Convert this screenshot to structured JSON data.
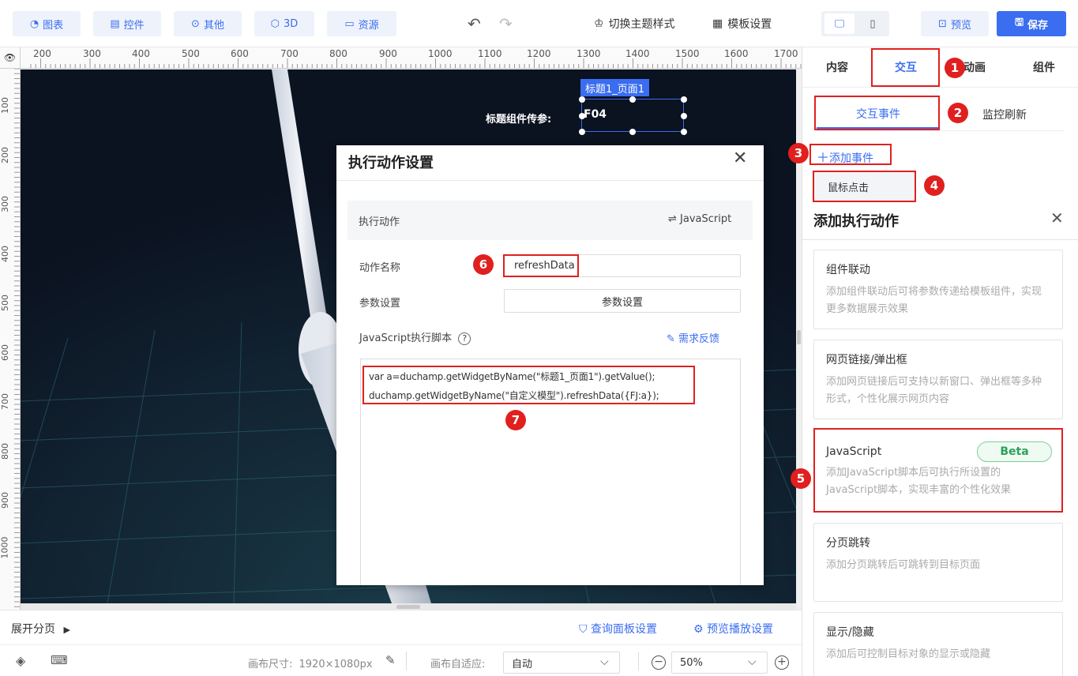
{
  "toolbar": {
    "chart": "图表",
    "widget": "控件",
    "other": "其他",
    "three_d": "3D",
    "resource": "资源",
    "switch_theme": "切换主题样式",
    "template_settings": "模板设置",
    "preview": "预览",
    "save": "保存"
  },
  "ruler": {
    "top": [
      "200",
      "300",
      "400",
      "500",
      "600",
      "700",
      "800",
      "900",
      "1000",
      "1100",
      "1200",
      "1300",
      "1400",
      "1500",
      "1600",
      "1700"
    ],
    "left": [
      "100",
      "200",
      "300",
      "400",
      "500",
      "600",
      "700",
      "800",
      "900",
      "1000"
    ]
  },
  "stage": {
    "widget_tag": "标题1_页面1",
    "param_label": "标题组件传参:",
    "widget_value": "F04"
  },
  "dialog": {
    "title": "执行动作设置",
    "exec_action_label": "执行动作",
    "exec_action_type": "JavaScript",
    "action_name_label": "动作名称",
    "action_name_value": "refreshData",
    "param_label": "参数设置",
    "param_button": "参数设置",
    "script_label": "JavaScript执行脚本",
    "feedback": "需求反馈",
    "code_line1": "var a=duchamp.getWidgetByName(\"标题1_页面1\").getValue();",
    "code_line2": "duchamp.getWidgetByName(\"自定义模型\").refreshData({FJ:a});"
  },
  "bottom": {
    "expand_pages": "展开分页",
    "query_panel": "查询面板设置",
    "preview_play": "预览播放设置",
    "canvas_size_label": "画布尺寸:",
    "canvas_size_value": "1920×1080px",
    "adapt_label": "画布自适应:",
    "adapt_value": "自动",
    "zoom_value": "50%"
  },
  "right_panel": {
    "tabs": [
      "内容",
      "交互",
      "动画",
      "组件"
    ],
    "subtabs": [
      "交互事件",
      "监控刷新"
    ],
    "add_event": "添加事件",
    "event_item": "鼠标点击",
    "add_action_title": "添加执行动作",
    "cards": [
      {
        "title": "组件联动",
        "desc": "添加组件联动后可将参数传递给模板组件，实现更多数据展示效果"
      },
      {
        "title": "网页链接/弹出框",
        "desc": "添加网页链接后可支持以新窗口、弹出框等多种形式，个性化展示网页内容"
      },
      {
        "title": "JavaScript",
        "desc": "添加JavaScript脚本后可执行所设置的JavaScript脚本，实现丰富的个性化效果",
        "badge": "Beta"
      },
      {
        "title": "分页跳转",
        "desc": "添加分页跳转后可跳转到目标页面"
      },
      {
        "title": "显示/隐藏",
        "desc": "添加后可控制目标对象的显示或隐藏"
      }
    ]
  },
  "annotations": [
    "1",
    "2",
    "3",
    "4",
    "5",
    "6",
    "7"
  ],
  "colors": {
    "accent": "#3a6df0",
    "annotation_red": "#e02020",
    "stage_bg": "#0b1220",
    "beta_green": "#2aa05a"
  }
}
